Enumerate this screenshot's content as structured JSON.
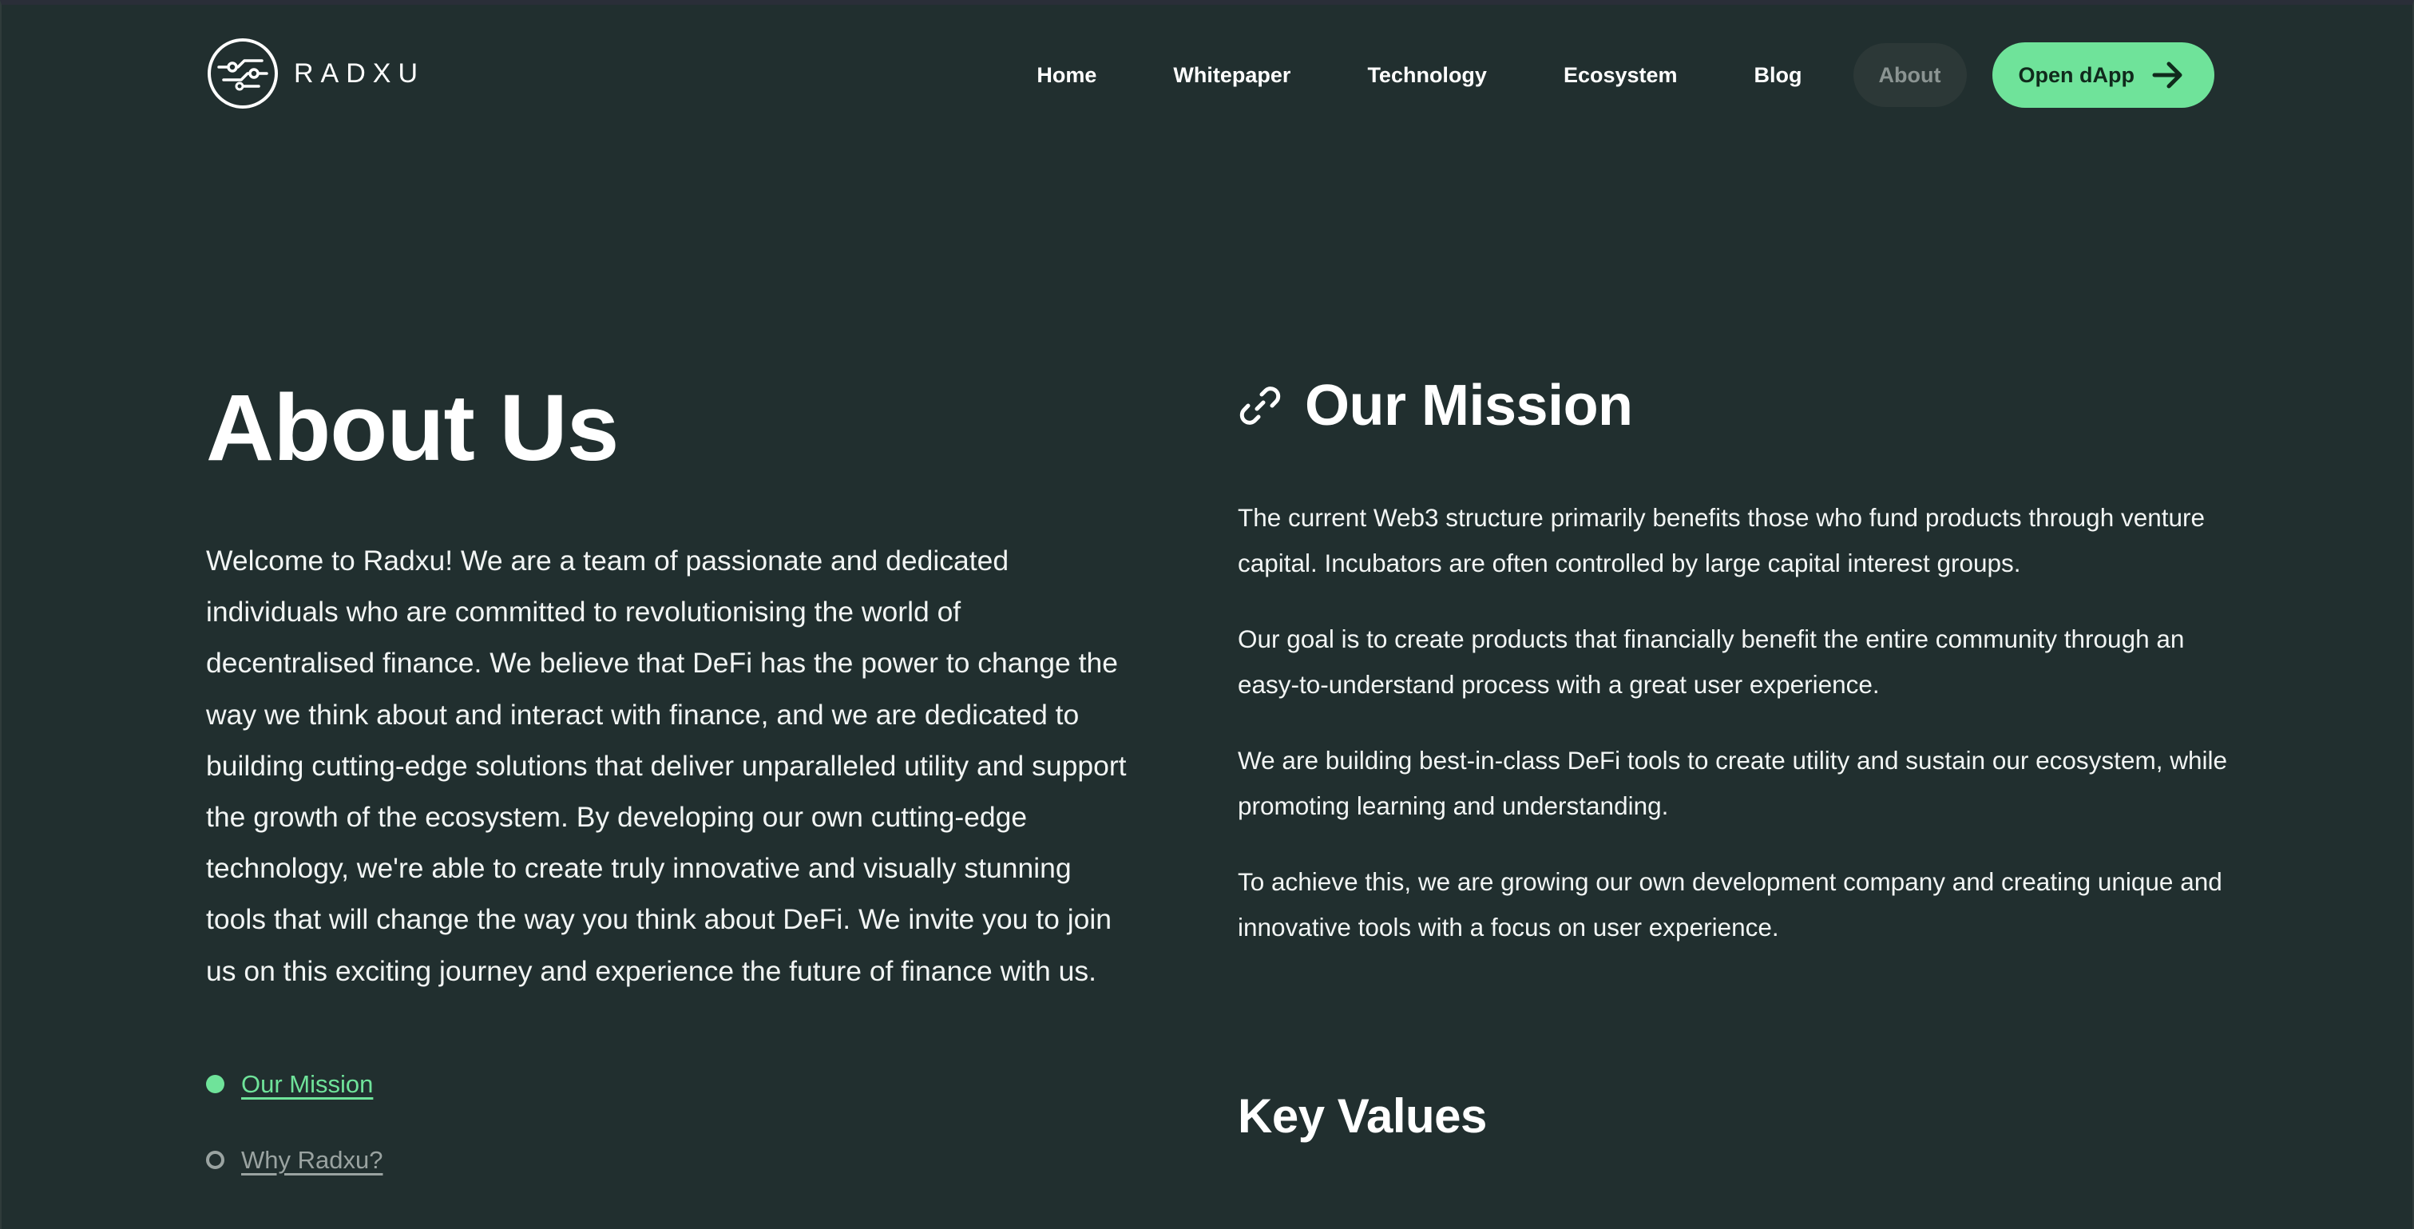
{
  "brand": {
    "name": "RADXU",
    "accent": "#6fe39a",
    "background": "#212f2f"
  },
  "nav": {
    "items": [
      {
        "label": "Home"
      },
      {
        "label": "Whitepaper"
      },
      {
        "label": "Technology"
      },
      {
        "label": "Ecosystem"
      },
      {
        "label": "Blog"
      },
      {
        "label": "About",
        "active": true
      }
    ],
    "cta_label": "Open dApp",
    "cta_icon": "arrow-right-icon"
  },
  "about": {
    "title": "About Us",
    "body": "Welcome to Radxu! We are a team of passionate and dedicated individuals who are committed to revolutionising the world of decentralised finance. We believe that DeFi has the power to change the way we think about and interact with finance, and we are dedicated to building cutting-edge solutions that deliver unparalleled utility and support the growth of the ecosystem. By developing our own cutting-edge technology, we're able to create truly innovative and visually stunning tools that will change the way you think about DeFi. We invite you to join us on this exciting journey and experience the future of finance with us.",
    "toc": [
      {
        "label": "Our Mission",
        "current": true
      },
      {
        "label": "Why Radxu?",
        "current": false
      }
    ]
  },
  "mission": {
    "icon": "link-icon",
    "title": "Our Mission",
    "paragraphs": [
      "The current Web3 structure primarily benefits those who fund products through venture capital. Incubators are often controlled by large capital interest groups.",
      "Our goal is to create products that financially benefit the entire community through an easy-to-understand process with a great user experience.",
      "We are building best-in-class DeFi tools to create utility and sustain our ecosystem, while promoting learning and understanding.",
      "To achieve this, we are growing our own development company and creating unique and innovative tools with a focus on user experience."
    ]
  },
  "key_values": {
    "title": "Key Values"
  }
}
